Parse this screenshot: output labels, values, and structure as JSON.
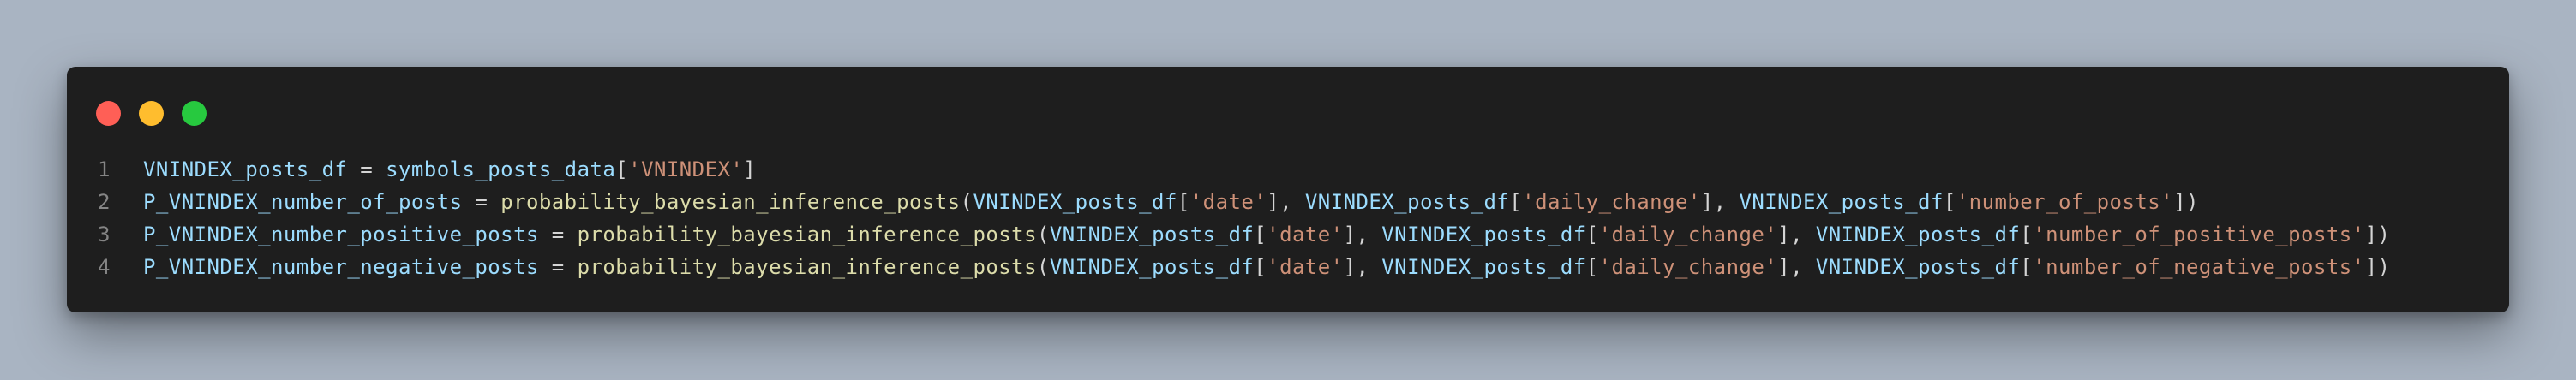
{
  "colors": {
    "background": "#a9b4c2",
    "editor_background": "#1e1e1e",
    "close_dot": "#ff5f56",
    "minimize_dot": "#ffbd2e",
    "maximize_dot": "#27c93f",
    "variable": "#9cdcfe",
    "function": "#dcdcaa",
    "string": "#ce9178",
    "punctuation": "#d4d4d4",
    "line_number": "#858585"
  },
  "window_controls": [
    "close",
    "minimize",
    "maximize"
  ],
  "code": {
    "language": "python",
    "lines": [
      {
        "number": "1",
        "tokens": [
          {
            "t": "var",
            "v": "VNINDEX_posts_df"
          },
          {
            "t": "pun",
            "v": " = "
          },
          {
            "t": "var",
            "v": "symbols_posts_data"
          },
          {
            "t": "pun",
            "v": "["
          },
          {
            "t": "str",
            "v": "'VNINDEX'"
          },
          {
            "t": "pun",
            "v": "]"
          }
        ]
      },
      {
        "number": "2",
        "tokens": [
          {
            "t": "var",
            "v": "P_VNINDEX_number_of_posts"
          },
          {
            "t": "pun",
            "v": " = "
          },
          {
            "t": "fn",
            "v": "probability_bayesian_inference_posts"
          },
          {
            "t": "pun",
            "v": "("
          },
          {
            "t": "var",
            "v": "VNINDEX_posts_df"
          },
          {
            "t": "pun",
            "v": "["
          },
          {
            "t": "str",
            "v": "'date'"
          },
          {
            "t": "pun",
            "v": "], "
          },
          {
            "t": "var",
            "v": "VNINDEX_posts_df"
          },
          {
            "t": "pun",
            "v": "["
          },
          {
            "t": "str",
            "v": "'daily_change'"
          },
          {
            "t": "pun",
            "v": "], "
          },
          {
            "t": "var",
            "v": "VNINDEX_posts_df"
          },
          {
            "t": "pun",
            "v": "["
          },
          {
            "t": "str",
            "v": "'number_of_posts'"
          },
          {
            "t": "pun",
            "v": "])"
          }
        ]
      },
      {
        "number": "3",
        "tokens": [
          {
            "t": "var",
            "v": "P_VNINDEX_number_positive_posts"
          },
          {
            "t": "pun",
            "v": " = "
          },
          {
            "t": "fn",
            "v": "probability_bayesian_inference_posts"
          },
          {
            "t": "pun",
            "v": "("
          },
          {
            "t": "var",
            "v": "VNINDEX_posts_df"
          },
          {
            "t": "pun",
            "v": "["
          },
          {
            "t": "str",
            "v": "'date'"
          },
          {
            "t": "pun",
            "v": "], "
          },
          {
            "t": "var",
            "v": "VNINDEX_posts_df"
          },
          {
            "t": "pun",
            "v": "["
          },
          {
            "t": "str",
            "v": "'daily_change'"
          },
          {
            "t": "pun",
            "v": "], "
          },
          {
            "t": "var",
            "v": "VNINDEX_posts_df"
          },
          {
            "t": "pun",
            "v": "["
          },
          {
            "t": "str",
            "v": "'number_of_positive_posts'"
          },
          {
            "t": "pun",
            "v": "])"
          }
        ]
      },
      {
        "number": "4",
        "tokens": [
          {
            "t": "var",
            "v": "P_VNINDEX_number_negative_posts"
          },
          {
            "t": "pun",
            "v": " = "
          },
          {
            "t": "fn",
            "v": "probability_bayesian_inference_posts"
          },
          {
            "t": "pun",
            "v": "("
          },
          {
            "t": "var",
            "v": "VNINDEX_posts_df"
          },
          {
            "t": "pun",
            "v": "["
          },
          {
            "t": "str",
            "v": "'date'"
          },
          {
            "t": "pun",
            "v": "], "
          },
          {
            "t": "var",
            "v": "VNINDEX_posts_df"
          },
          {
            "t": "pun",
            "v": "["
          },
          {
            "t": "str",
            "v": "'daily_change'"
          },
          {
            "t": "pun",
            "v": "], "
          },
          {
            "t": "var",
            "v": "VNINDEX_posts_df"
          },
          {
            "t": "pun",
            "v": "["
          },
          {
            "t": "str",
            "v": "'number_of_negative_posts'"
          },
          {
            "t": "pun",
            "v": "])"
          }
        ]
      }
    ]
  }
}
